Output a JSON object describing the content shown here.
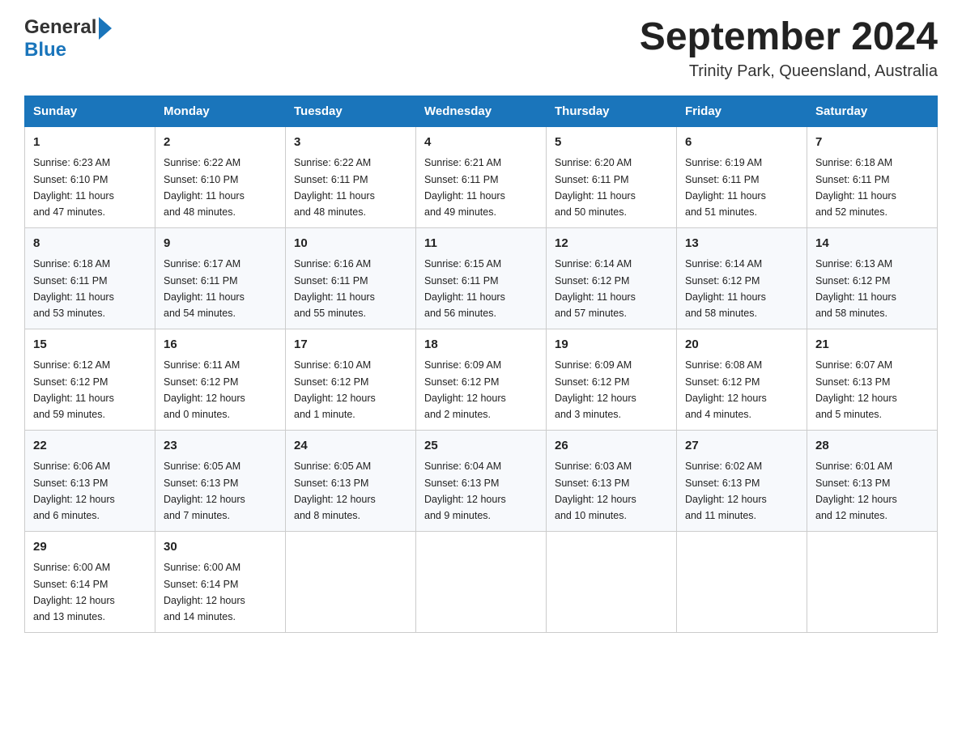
{
  "header": {
    "logo_general": "General",
    "logo_blue": "Blue",
    "month_title": "September 2024",
    "location": "Trinity Park, Queensland, Australia"
  },
  "days_of_week": [
    "Sunday",
    "Monday",
    "Tuesday",
    "Wednesday",
    "Thursday",
    "Friday",
    "Saturday"
  ],
  "weeks": [
    [
      {
        "day": "1",
        "sunrise": "6:23 AM",
        "sunset": "6:10 PM",
        "daylight": "11 hours and 47 minutes."
      },
      {
        "day": "2",
        "sunrise": "6:22 AM",
        "sunset": "6:10 PM",
        "daylight": "11 hours and 48 minutes."
      },
      {
        "day": "3",
        "sunrise": "6:22 AM",
        "sunset": "6:11 PM",
        "daylight": "11 hours and 48 minutes."
      },
      {
        "day": "4",
        "sunrise": "6:21 AM",
        "sunset": "6:11 PM",
        "daylight": "11 hours and 49 minutes."
      },
      {
        "day": "5",
        "sunrise": "6:20 AM",
        "sunset": "6:11 PM",
        "daylight": "11 hours and 50 minutes."
      },
      {
        "day": "6",
        "sunrise": "6:19 AM",
        "sunset": "6:11 PM",
        "daylight": "11 hours and 51 minutes."
      },
      {
        "day": "7",
        "sunrise": "6:18 AM",
        "sunset": "6:11 PM",
        "daylight": "11 hours and 52 minutes."
      }
    ],
    [
      {
        "day": "8",
        "sunrise": "6:18 AM",
        "sunset": "6:11 PM",
        "daylight": "11 hours and 53 minutes."
      },
      {
        "day": "9",
        "sunrise": "6:17 AM",
        "sunset": "6:11 PM",
        "daylight": "11 hours and 54 minutes."
      },
      {
        "day": "10",
        "sunrise": "6:16 AM",
        "sunset": "6:11 PM",
        "daylight": "11 hours and 55 minutes."
      },
      {
        "day": "11",
        "sunrise": "6:15 AM",
        "sunset": "6:11 PM",
        "daylight": "11 hours and 56 minutes."
      },
      {
        "day": "12",
        "sunrise": "6:14 AM",
        "sunset": "6:12 PM",
        "daylight": "11 hours and 57 minutes."
      },
      {
        "day": "13",
        "sunrise": "6:14 AM",
        "sunset": "6:12 PM",
        "daylight": "11 hours and 58 minutes."
      },
      {
        "day": "14",
        "sunrise": "6:13 AM",
        "sunset": "6:12 PM",
        "daylight": "11 hours and 58 minutes."
      }
    ],
    [
      {
        "day": "15",
        "sunrise": "6:12 AM",
        "sunset": "6:12 PM",
        "daylight": "11 hours and 59 minutes."
      },
      {
        "day": "16",
        "sunrise": "6:11 AM",
        "sunset": "6:12 PM",
        "daylight": "12 hours and 0 minutes."
      },
      {
        "day": "17",
        "sunrise": "6:10 AM",
        "sunset": "6:12 PM",
        "daylight": "12 hours and 1 minute."
      },
      {
        "day": "18",
        "sunrise": "6:09 AM",
        "sunset": "6:12 PM",
        "daylight": "12 hours and 2 minutes."
      },
      {
        "day": "19",
        "sunrise": "6:09 AM",
        "sunset": "6:12 PM",
        "daylight": "12 hours and 3 minutes."
      },
      {
        "day": "20",
        "sunrise": "6:08 AM",
        "sunset": "6:12 PM",
        "daylight": "12 hours and 4 minutes."
      },
      {
        "day": "21",
        "sunrise": "6:07 AM",
        "sunset": "6:13 PM",
        "daylight": "12 hours and 5 minutes."
      }
    ],
    [
      {
        "day": "22",
        "sunrise": "6:06 AM",
        "sunset": "6:13 PM",
        "daylight": "12 hours and 6 minutes."
      },
      {
        "day": "23",
        "sunrise": "6:05 AM",
        "sunset": "6:13 PM",
        "daylight": "12 hours and 7 minutes."
      },
      {
        "day": "24",
        "sunrise": "6:05 AM",
        "sunset": "6:13 PM",
        "daylight": "12 hours and 8 minutes."
      },
      {
        "day": "25",
        "sunrise": "6:04 AM",
        "sunset": "6:13 PM",
        "daylight": "12 hours and 9 minutes."
      },
      {
        "day": "26",
        "sunrise": "6:03 AM",
        "sunset": "6:13 PM",
        "daylight": "12 hours and 10 minutes."
      },
      {
        "day": "27",
        "sunrise": "6:02 AM",
        "sunset": "6:13 PM",
        "daylight": "12 hours and 11 minutes."
      },
      {
        "day": "28",
        "sunrise": "6:01 AM",
        "sunset": "6:13 PM",
        "daylight": "12 hours and 12 minutes."
      }
    ],
    [
      {
        "day": "29",
        "sunrise": "6:00 AM",
        "sunset": "6:14 PM",
        "daylight": "12 hours and 13 minutes."
      },
      {
        "day": "30",
        "sunrise": "6:00 AM",
        "sunset": "6:14 PM",
        "daylight": "12 hours and 14 minutes."
      },
      null,
      null,
      null,
      null,
      null
    ]
  ],
  "labels": {
    "sunrise": "Sunrise:",
    "sunset": "Sunset:",
    "daylight": "Daylight:"
  }
}
